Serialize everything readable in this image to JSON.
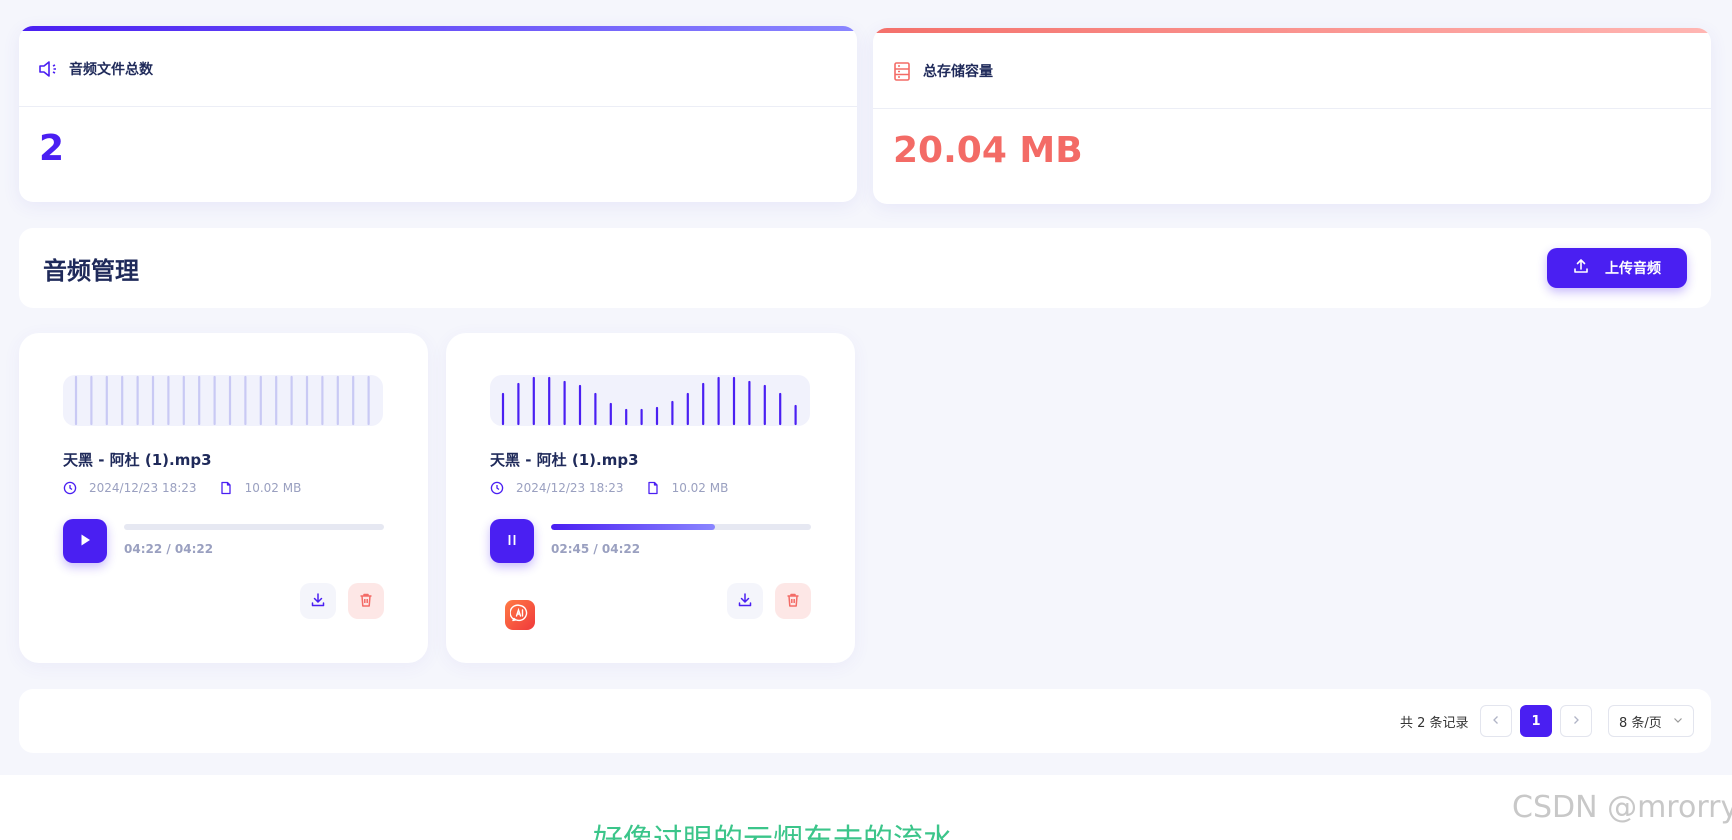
{
  "stats": {
    "count_label": "音频文件总数",
    "count_value": "2",
    "storage_label": "总存储容量",
    "storage_value": "20.04 MB"
  },
  "section": {
    "title": "音频管理",
    "upload_label": "上传音频"
  },
  "audios": [
    {
      "name": "天黑 - 阿杜 (1).mp3",
      "date": "2024/12/23 18:23",
      "size": "10.02 MB",
      "time": "04:22 / 04:22",
      "progress": 0,
      "state": "paused",
      "waveform_active": false
    },
    {
      "name": "天黑 - 阿杜 (1).mp3",
      "date": "2024/12/23 18:23",
      "size": "10.02 MB",
      "time": "02:45 / 04:22",
      "progress": 0.63,
      "state": "playing",
      "waveform_active": true
    }
  ],
  "pagination": {
    "total": "共 2 条记录",
    "current_page": "1",
    "page_size": "8 条/页"
  },
  "footer": {
    "lyric": "好像过眼的云烟东去的流水",
    "watermark": "CSDN @mrorry"
  },
  "colors": {
    "accent": "#4a1ff2",
    "danger": "#f36b66",
    "lyric": "#3bc58a"
  },
  "icons": {
    "count": "speaker-icon",
    "storage": "storage-icon",
    "upload": "upload-icon",
    "clock": "clock-icon",
    "file": "file-icon",
    "play": "play-icon",
    "pause": "pause-icon",
    "download": "download-icon",
    "delete": "trash-icon",
    "ai": "ai-icon"
  }
}
